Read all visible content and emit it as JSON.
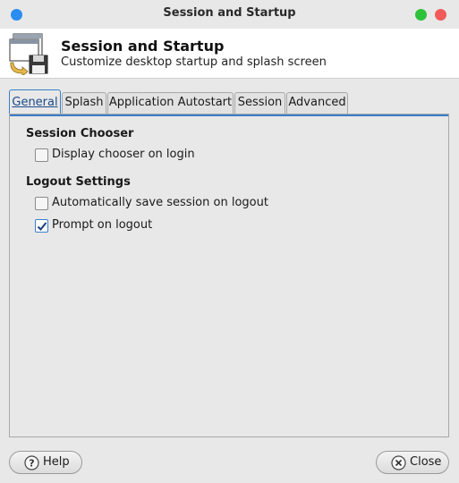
{
  "window": {
    "title": "Session and Startup"
  },
  "header": {
    "title": "Session and Startup",
    "subtitle": "Customize desktop startup and splash screen"
  },
  "tabs": [
    {
      "label": "General",
      "active": true
    },
    {
      "label": "Splash"
    },
    {
      "label": "Application Autostart"
    },
    {
      "label": "Session"
    },
    {
      "label": "Advanced"
    }
  ],
  "general": {
    "session_chooser": {
      "heading": "Session Chooser",
      "display_chooser": {
        "label": "Display chooser on login",
        "checked": false
      }
    },
    "logout_settings": {
      "heading": "Logout Settings",
      "auto_save": {
        "label": "Automatically save session on logout",
        "checked": false
      },
      "prompt": {
        "label": "Prompt on logout",
        "checked": true
      }
    }
  },
  "buttons": {
    "help": "Help",
    "close": "Close"
  },
  "icons": {
    "window_menu": "menu-dot-icon",
    "maximize": "maximize-dot-icon",
    "close": "close-dot-icon",
    "app": "session-startup-icon",
    "help": "help-icon",
    "close_button": "close-circle-icon",
    "check": "checkmark-icon"
  },
  "colors": {
    "accent": "#3a7fc8",
    "close_dot": "#f25a5a",
    "max_dot": "#2ec23a",
    "menu_dot": "#2a8ef0"
  }
}
